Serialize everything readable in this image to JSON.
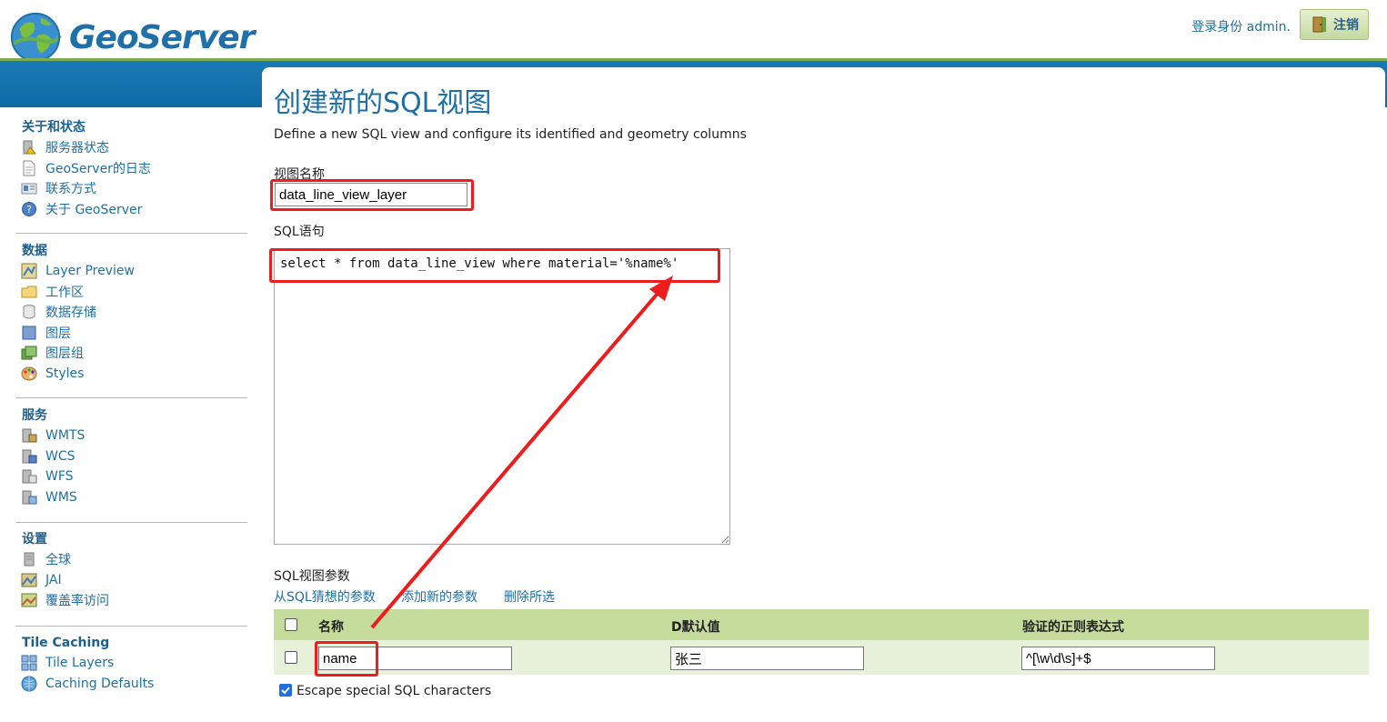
{
  "header": {
    "logo_text": "GeoServer",
    "login_info": "登录身份 admin.",
    "logout_label": "注销"
  },
  "sidebar": {
    "sections": [
      {
        "title": "关于和状态",
        "items": [
          {
            "label": "服务器状态",
            "icon": "server-status-icon"
          },
          {
            "label": "GeoServer的日志",
            "icon": "log-document-icon"
          },
          {
            "label": "联系方式",
            "icon": "contact-card-icon"
          },
          {
            "label": "关于 GeoServer",
            "icon": "about-help-icon"
          }
        ]
      },
      {
        "title": "数据",
        "items": [
          {
            "label": "Layer Preview",
            "icon": "layer-preview-icon"
          },
          {
            "label": "工作区",
            "icon": "folder-icon"
          },
          {
            "label": "数据存储",
            "icon": "database-icon"
          },
          {
            "label": "图层",
            "icon": "layer-icon"
          },
          {
            "label": "图层组",
            "icon": "layer-group-icon"
          },
          {
            "label": "Styles",
            "icon": "palette-icon"
          }
        ]
      },
      {
        "title": "服务",
        "items": [
          {
            "label": "WMTS",
            "icon": "wmts-service-icon"
          },
          {
            "label": "WCS",
            "icon": "wcs-service-icon"
          },
          {
            "label": "WFS",
            "icon": "wfs-service-icon"
          },
          {
            "label": "WMS",
            "icon": "wms-service-icon"
          }
        ]
      },
      {
        "title": "设置",
        "items": [
          {
            "label": "全球",
            "icon": "global-settings-icon"
          },
          {
            "label": "JAI",
            "icon": "jai-icon"
          },
          {
            "label": "覆盖率访问",
            "icon": "coverage-access-icon"
          }
        ]
      },
      {
        "title": "Tile Caching",
        "items": [
          {
            "label": "Tile Layers",
            "icon": "tile-layers-icon"
          },
          {
            "label": "Caching Defaults",
            "icon": "caching-defaults-icon"
          }
        ]
      }
    ]
  },
  "main": {
    "title": "创建新的SQL视图",
    "description": "Define a new SQL view and configure its identified and geometry columns",
    "view_name_label": "视图名称",
    "view_name_value": "data_line_view_layer",
    "sql_label": "SQL语句",
    "sql_value": "select * from data_line_view where material='%name%'",
    "params_label": "SQL视图参数",
    "links": {
      "guess": "从SQL猜想的参数",
      "add": "添加新的参数",
      "delete": "删除所选"
    },
    "table": {
      "headers": [
        "名称",
        "D默认值",
        "验证的正则表达式"
      ],
      "rows": [
        {
          "name": "name",
          "default": "张三",
          "regex": "^[\\w\\d\\s]+$"
        }
      ]
    },
    "escape_label": "Escape special SQL characters",
    "escape_checked": true
  },
  "colors": {
    "accent_blue": "#1d6fa5",
    "band_blue": "#0e6aa3",
    "table_header_green": "#c6dc9c",
    "highlight_red": "#ee1c1c"
  }
}
